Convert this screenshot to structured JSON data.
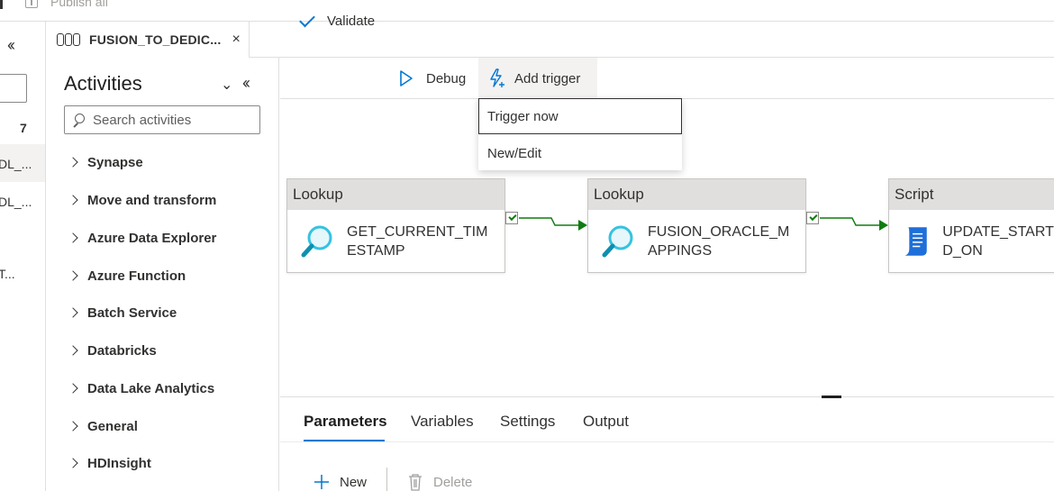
{
  "top": {
    "publish_label": "Publish all"
  },
  "left_strip": {
    "count": "7",
    "items": [
      "DL_...",
      "DL_...",
      "T..."
    ]
  },
  "tab": {
    "title": "FUSION_TO_DEDIC...",
    "close": "×"
  },
  "activities": {
    "heading": "Activities",
    "search_placeholder": "Search activities",
    "categories": [
      "Synapse",
      "Move and transform",
      "Azure Data Explorer",
      "Azure Function",
      "Batch Service",
      "Databricks",
      "Data Lake Analytics",
      "General",
      "HDInsight"
    ]
  },
  "commands": {
    "validate": "Validate",
    "debug": "Debug",
    "add_trigger": "Add trigger"
  },
  "trigger_menu": {
    "items": [
      "Trigger now",
      "New/Edit"
    ]
  },
  "pipeline": {
    "activities": [
      {
        "type": "Lookup",
        "name": "GET_CURRENT_TIMESTAMP",
        "icon": "lookup-icon"
      },
      {
        "type": "Lookup",
        "name": "FUSION_ORACLE_MAPPINGS",
        "icon": "lookup-icon"
      },
      {
        "type": "Script",
        "name": "UPDATE_STARTED_ON",
        "icon": "script-icon"
      }
    ],
    "accent": "#0078d4",
    "success_color": "#107c10"
  },
  "bottom": {
    "tabs": [
      "Parameters",
      "Variables",
      "Settings",
      "Output"
    ],
    "new_label": "New",
    "delete_label": "Delete"
  }
}
